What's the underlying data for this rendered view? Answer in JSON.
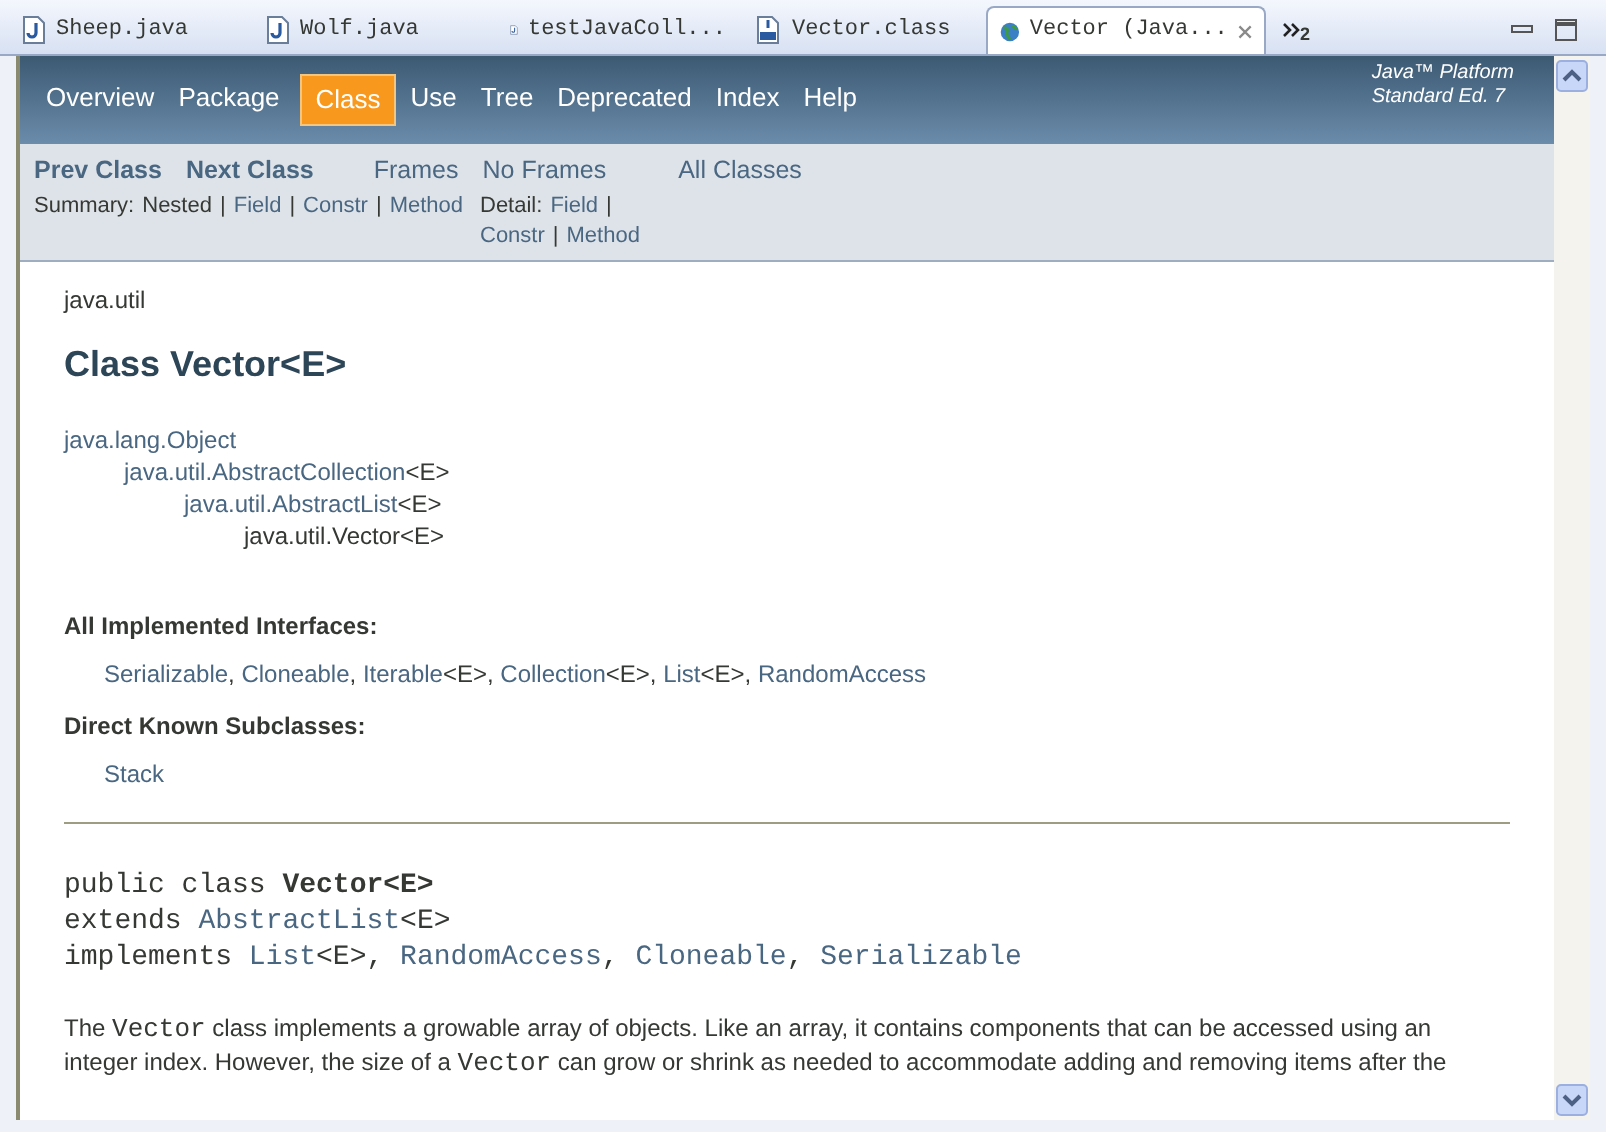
{
  "tabs": [
    {
      "label": "Sheep.java",
      "kind": "java",
      "selected": false
    },
    {
      "label": "Wolf.java",
      "kind": "java",
      "selected": false
    },
    {
      "label": "testJavaColl...",
      "kind": "java",
      "selected": false
    },
    {
      "label": "Vector.class",
      "kind": "class",
      "selected": false
    },
    {
      "label": "Vector (Java...",
      "kind": "browser",
      "selected": true
    }
  ],
  "tab_overflow": {
    "count": "2"
  },
  "nav": {
    "items": [
      {
        "label": "Overview",
        "selected": false
      },
      {
        "label": "Package",
        "selected": false
      },
      {
        "label": "Class",
        "selected": true
      },
      {
        "label": "Use",
        "selected": false
      },
      {
        "label": "Tree",
        "selected": false
      },
      {
        "label": "Deprecated",
        "selected": false
      },
      {
        "label": "Index",
        "selected": false
      },
      {
        "label": "Help",
        "selected": false
      }
    ],
    "platform": [
      "Java™ Platform",
      "Standard Ed. 7"
    ]
  },
  "subnav": {
    "class_links": [
      "Prev Class",
      "Next Class"
    ],
    "frame_links": [
      "Frames",
      "No Frames"
    ],
    "all_classes": "All Classes",
    "summary": {
      "label": "Summary:",
      "separator": "|",
      "parts": [
        {
          "text": "Nested",
          "link": false
        },
        {
          "text": "Field",
          "link": true
        },
        {
          "text": "Constr",
          "link": true
        },
        {
          "text": "Method",
          "link": true
        }
      ]
    },
    "detail": {
      "label": "Detail:",
      "separator": "|",
      "parts": [
        {
          "text": "Field",
          "link": true
        },
        {
          "text": "Constr",
          "link": true
        },
        {
          "text": "Method",
          "link": true
        }
      ]
    }
  },
  "package": "java.util",
  "title": "Class Vector<E>",
  "hierarchy": {
    "name": "java.lang.Object",
    "link": true,
    "children": [
      {
        "name": "java.util.AbstractCollection",
        "type_param": "<E>",
        "link": true,
        "children": [
          {
            "name": "java.util.AbstractList",
            "type_param": "<E>",
            "link": true,
            "children": [
              {
                "name": "java.util.Vector",
                "type_param": "<E>",
                "link": false
              }
            ]
          }
        ]
      }
    ]
  },
  "interfaces": {
    "heading": "All Implemented Interfaces:",
    "separator": ", ",
    "items": [
      {
        "name": "Serializable"
      },
      {
        "name": "Cloneable"
      },
      {
        "name": "Iterable",
        "type_param": "<E>"
      },
      {
        "name": "Collection",
        "type_param": "<E>"
      },
      {
        "name": "List",
        "type_param": "<E>"
      },
      {
        "name": "RandomAccess"
      }
    ]
  },
  "subclasses": {
    "heading": "Direct Known Subclasses:",
    "items": [
      "Stack"
    ]
  },
  "declaration": [
    [
      {
        "text": "public class ",
        "kind": "text"
      },
      {
        "text": "Vector<E>",
        "kind": "name"
      }
    ],
    [
      {
        "text": "extends ",
        "kind": "text"
      },
      {
        "text": "AbstractList",
        "kind": "link"
      },
      {
        "text": "<E>",
        "kind": "text"
      }
    ],
    [
      {
        "text": "implements ",
        "kind": "text"
      },
      {
        "text": "List",
        "kind": "link"
      },
      {
        "text": "<E>, ",
        "kind": "text"
      },
      {
        "text": "RandomAccess",
        "kind": "link"
      },
      {
        "text": ", ",
        "kind": "text"
      },
      {
        "text": "Cloneable",
        "kind": "link"
      },
      {
        "text": ", ",
        "kind": "text"
      },
      {
        "text": "Serializable",
        "kind": "link"
      }
    ]
  ],
  "description": [
    {
      "text": "The ",
      "code": false
    },
    {
      "text": "Vector",
      "code": true
    },
    {
      "text": " class implements a growable array of objects. Like an array, it contains components that can be accessed using an integer index. However, the size of a ",
      "code": false
    },
    {
      "text": "Vector",
      "code": true
    },
    {
      "text": " can grow or shrink as needed to accommodate adding and removing items after the",
      "code": false
    }
  ]
}
